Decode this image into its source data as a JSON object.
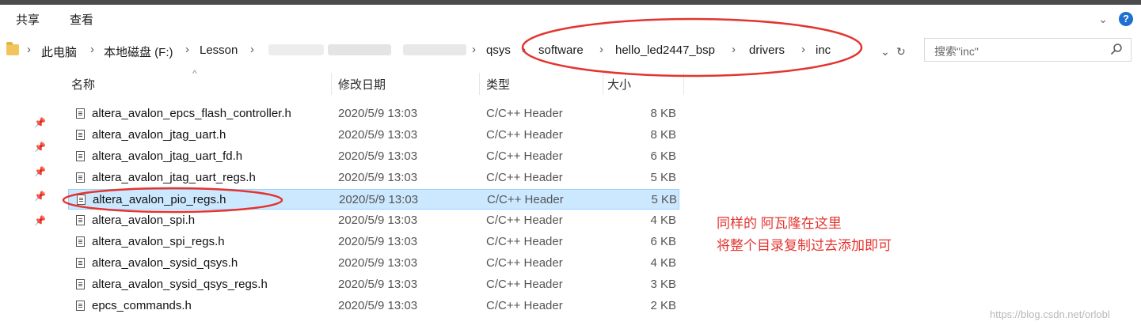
{
  "ribbon": {
    "tab_share": "共享",
    "tab_view": "查看",
    "collapse_icon": "chevron-down-icon",
    "help_label": "?"
  },
  "address": {
    "crumbs": [
      "此电脑",
      "本地磁盘 (F:)",
      "Lesson",
      "qsys",
      "software",
      "hello_led2447_bsp",
      "drivers",
      "inc"
    ],
    "dropdown_icon": "chevron-down-icon",
    "refresh_icon": "refresh-icon"
  },
  "search": {
    "placeholder": "搜索\"inc\"",
    "icon": "search-icon"
  },
  "columns": {
    "name": "名称",
    "date": "修改日期",
    "type": "类型",
    "size": "大小",
    "sort_indicator": "^"
  },
  "files": [
    {
      "name": "altera_avalon_epcs_flash_controller.h",
      "date": "2020/5/9 13:03",
      "type": "C/C++ Header",
      "size": "8 KB"
    },
    {
      "name": "altera_avalon_jtag_uart.h",
      "date": "2020/5/9 13:03",
      "type": "C/C++ Header",
      "size": "8 KB"
    },
    {
      "name": "altera_avalon_jtag_uart_fd.h",
      "date": "2020/5/9 13:03",
      "type": "C/C++ Header",
      "size": "6 KB"
    },
    {
      "name": "altera_avalon_jtag_uart_regs.h",
      "date": "2020/5/9 13:03",
      "type": "C/C++ Header",
      "size": "5 KB"
    },
    {
      "name": "altera_avalon_pio_regs.h",
      "date": "2020/5/9 13:03",
      "type": "C/C++ Header",
      "size": "5 KB",
      "selected": true
    },
    {
      "name": "altera_avalon_spi.h",
      "date": "2020/5/9 13:03",
      "type": "C/C++ Header",
      "size": "4 KB"
    },
    {
      "name": "altera_avalon_spi_regs.h",
      "date": "2020/5/9 13:03",
      "type": "C/C++ Header",
      "size": "6 KB"
    },
    {
      "name": "altera_avalon_sysid_qsys.h",
      "date": "2020/5/9 13:03",
      "type": "C/C++ Header",
      "size": "4 KB"
    },
    {
      "name": "altera_avalon_sysid_qsys_regs.h",
      "date": "2020/5/9 13:03",
      "type": "C/C++ Header",
      "size": "3 KB"
    },
    {
      "name": "epcs_commands.h",
      "date": "2020/5/9 13:03",
      "type": "C/C++ Header",
      "size": "2 KB"
    }
  ],
  "annotation": {
    "line1": "同样的  阿瓦隆在这里",
    "line2": "将整个目录复制过去添加即可",
    "color": "#e3342f"
  },
  "watermark": "https://blog.csdn.net/orlobl"
}
